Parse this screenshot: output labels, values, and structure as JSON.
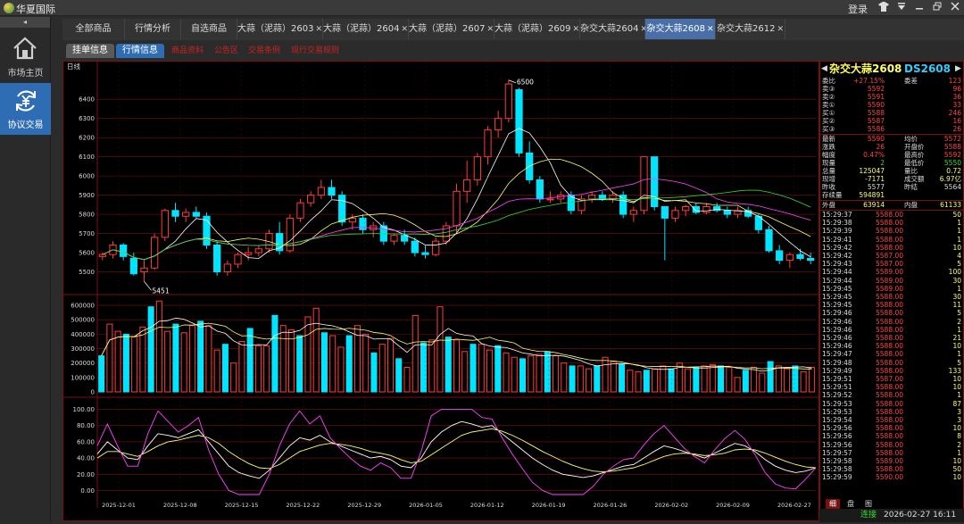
{
  "app": {
    "title": "华夏国际",
    "login": "登录"
  },
  "sidebar": {
    "collapse_icon": "◂",
    "items": [
      {
        "label": "市场主页",
        "icon": "home-icon",
        "active": false
      },
      {
        "label": "协议交易",
        "icon": "yuan-exchange-icon",
        "active": true
      }
    ]
  },
  "tabs": [
    {
      "label": "全部商品",
      "closable": false,
      "active": false
    },
    {
      "label": "行情分析",
      "closable": false,
      "active": false
    },
    {
      "label": "自选商品",
      "closable": false,
      "active": false
    },
    {
      "label": "大蒜（泥蒜）2603",
      "closable": true,
      "active": false
    },
    {
      "label": "大蒜（泥蒜）2604",
      "closable": true,
      "active": false
    },
    {
      "label": "大蒜（泥蒜）2607",
      "closable": true,
      "active": false
    },
    {
      "label": "大蒜（泥蒜）2609",
      "closable": true,
      "active": false
    },
    {
      "label": "杂交大蒜2604",
      "closable": true,
      "active": false
    },
    {
      "label": "杂交大蒜2608",
      "closable": true,
      "active": true
    },
    {
      "label": "杂交大蒜2612",
      "closable": true,
      "active": false
    }
  ],
  "subtabs": {
    "buttons": [
      "挂单信息",
      "行情信息"
    ],
    "links": [
      "商品资料",
      "公告区",
      "交易条例",
      "现行交易规则"
    ]
  },
  "chart": {
    "period_label": "日线",
    "price_high_label": "6500",
    "price_low_label": "5451",
    "colors": {
      "up": "#ff3b3b",
      "down": "#00e5ff",
      "ma1": "#ffffff",
      "ma2": "#ffff66",
      "ma3": "#ff44ff",
      "ma4": "#33dd33",
      "grid": "#7a1010"
    }
  },
  "chart_data": [
    {
      "type": "candlestick",
      "panel": "price",
      "ylim": [
        5400,
        6550
      ],
      "yticks": [
        5500,
        5600,
        5700,
        5800,
        5900,
        6000,
        6100,
        6200,
        6300,
        6400
      ],
      "x_tick_labels": [
        "2025-12-01",
        "2025-12-08",
        "2025-12-15",
        "2025-12-22",
        "2025-12-29",
        "2026-01-05",
        "2026-01-12",
        "2026-01-19",
        "2026-01-26",
        "2026-02-02",
        "2026-02-09",
        "2026-02-27"
      ],
      "candles": [
        [
          5580,
          5600,
          5560,
          5590
        ],
        [
          5590,
          5660,
          5570,
          5640
        ],
        [
          5640,
          5650,
          5560,
          5580
        ],
        [
          5570,
          5600,
          5480,
          5490
        ],
        [
          5500,
          5560,
          5450,
          5520
        ],
        [
          5520,
          5700,
          5510,
          5680
        ],
        [
          5680,
          5830,
          5660,
          5820
        ],
        [
          5820,
          5860,
          5760,
          5790
        ],
        [
          5790,
          5830,
          5760,
          5810
        ],
        [
          5810,
          5840,
          5780,
          5790
        ],
        [
          5790,
          5810,
          5620,
          5640
        ],
        [
          5640,
          5660,
          5480,
          5500
        ],
        [
          5500,
          5560,
          5480,
          5540
        ],
        [
          5540,
          5600,
          5520,
          5590
        ],
        [
          5590,
          5630,
          5560,
          5600
        ],
        [
          5600,
          5640,
          5580,
          5620
        ],
        [
          5620,
          5720,
          5600,
          5700
        ],
        [
          5700,
          5760,
          5590,
          5610
        ],
        [
          5610,
          5800,
          5600,
          5780
        ],
        [
          5780,
          5880,
          5760,
          5860
        ],
        [
          5860,
          5920,
          5840,
          5900
        ],
        [
          5900,
          5980,
          5880,
          5940
        ],
        [
          5940,
          5980,
          5880,
          5900
        ],
        [
          5900,
          5920,
          5740,
          5760
        ],
        [
          5760,
          5800,
          5720,
          5780
        ],
        [
          5780,
          5800,
          5700,
          5720
        ],
        [
          5720,
          5760,
          5680,
          5740
        ],
        [
          5740,
          5760,
          5640,
          5660
        ],
        [
          5660,
          5700,
          5640,
          5690
        ],
        [
          5690,
          5720,
          5640,
          5660
        ],
        [
          5660,
          5680,
          5580,
          5600
        ],
        [
          5600,
          5640,
          5570,
          5590
        ],
        [
          5590,
          5680,
          5580,
          5660
        ],
        [
          5660,
          5760,
          5640,
          5740
        ],
        [
          5740,
          5960,
          5700,
          5920
        ],
        [
          5920,
          6080,
          5860,
          5980
        ],
        [
          5980,
          6120,
          5950,
          6100
        ],
        [
          6100,
          6260,
          6060,
          6240
        ],
        [
          6240,
          6340,
          6200,
          6300
        ],
        [
          6300,
          6500,
          6280,
          6480
        ],
        [
          6450,
          6460,
          6100,
          6120
        ],
        [
          6120,
          6180,
          5960,
          5980
        ],
        [
          5980,
          6000,
          5860,
          5880
        ],
        [
          5880,
          5920,
          5860,
          5880
        ],
        [
          5880,
          5920,
          5860,
          5900
        ],
        [
          5900,
          5920,
          5800,
          5820
        ],
        [
          5820,
          5900,
          5800,
          5880
        ],
        [
          5880,
          5920,
          5860,
          5900
        ],
        [
          5900,
          5920,
          5870,
          5880
        ],
        [
          5880,
          5920,
          5860,
          5900
        ],
        [
          5900,
          5920,
          5780,
          5800
        ],
        [
          5800,
          5840,
          5760,
          5820
        ],
        [
          5820,
          6100,
          5800,
          6100
        ],
        [
          6100,
          6100,
          5820,
          5840
        ],
        [
          5840,
          5840,
          5560,
          5780
        ],
        [
          5780,
          5840,
          5760,
          5820
        ],
        [
          5820,
          5850,
          5790,
          5840
        ],
        [
          5840,
          5860,
          5800,
          5810
        ],
        [
          5810,
          5860,
          5800,
          5840
        ],
        [
          5840,
          5860,
          5810,
          5820
        ],
        [
          5820,
          5840,
          5780,
          5800
        ],
        [
          5800,
          5840,
          5780,
          5820
        ],
        [
          5820,
          5840,
          5780,
          5790
        ],
        [
          5790,
          5800,
          5700,
          5720
        ],
        [
          5720,
          5740,
          5600,
          5610
        ],
        [
          5610,
          5640,
          5540,
          5560
        ],
        [
          5560,
          5600,
          5520,
          5590
        ],
        [
          5590,
          5620,
          5560,
          5570
        ],
        [
          5570,
          5600,
          5540,
          5560
        ]
      ]
    },
    {
      "type": "bar",
      "panel": "volume",
      "ylim": [
        0,
        650000
      ],
      "yticks": [
        0,
        100000,
        200000,
        300000,
        400000,
        500000,
        600000
      ],
      "values": [
        250000,
        470000,
        420000,
        400000,
        380000,
        450000,
        590000,
        630000,
        420000,
        470000,
        410000,
        460000,
        490000,
        460000,
        290000,
        330000,
        200000,
        350000,
        440000,
        320000,
        320000,
        530000,
        460000,
        430000,
        390000,
        520000,
        580000,
        410000,
        390000,
        310000,
        390000,
        460000,
        400000,
        270000,
        330000,
        370000,
        230000,
        170000,
        530000,
        340000,
        360000,
        590000,
        380000,
        360000,
        280000,
        330000,
        330000,
        290000,
        320000,
        270000,
        240000,
        230000,
        250000,
        260000,
        280000,
        250000,
        200000,
        180000,
        180000,
        160000,
        180000,
        240000,
        210000,
        190000,
        150000,
        140000,
        150000,
        160000,
        180000,
        160000,
        200000,
        160000,
        170000,
        180000,
        190000,
        180000,
        170000,
        100000,
        150000,
        170000,
        130000,
        210000,
        180000,
        160000,
        180000,
        140000,
        170000
      ]
    },
    {
      "type": "line",
      "panel": "indicator",
      "ylim": [
        -5,
        105
      ],
      "yticks": [
        0,
        20,
        40,
        60,
        80,
        100
      ],
      "series": [
        {
          "name": "K",
          "values": [
            45,
            60,
            50,
            40,
            38,
            55,
            70,
            68,
            65,
            70,
            75,
            60,
            45,
            30,
            22,
            18,
            15,
            25,
            40,
            55,
            65,
            62,
            68,
            60,
            55,
            50,
            45,
            40,
            42,
            38,
            30,
            28,
            40,
            60,
            72,
            80,
            85,
            82,
            78,
            80,
            70,
            60,
            50,
            40,
            32,
            25,
            20,
            18,
            16,
            18,
            22,
            26,
            30,
            32,
            40,
            48,
            55,
            52,
            48,
            44,
            40,
            46,
            52,
            58,
            55,
            48,
            38,
            30,
            25,
            22,
            24,
            28
          ]
        },
        {
          "name": "D",
          "values": [
            40,
            48,
            48,
            45,
            42,
            48,
            55,
            60,
            62,
            65,
            68,
            65,
            58,
            48,
            40,
            33,
            28,
            27,
            32,
            40,
            48,
            52,
            56,
            58,
            57,
            55,
            52,
            48,
            46,
            43,
            38,
            34,
            36,
            44,
            52,
            60,
            68,
            72,
            74,
            76,
            73,
            68,
            62,
            55,
            48,
            42,
            36,
            31,
            27,
            24,
            23,
            24,
            26,
            28,
            32,
            37,
            42,
            45,
            46,
            45,
            43,
            44,
            46,
            50,
            51,
            50,
            46,
            41,
            36,
            32,
            29,
            28
          ]
        },
        {
          "name": "J",
          "values": [
            55,
            82,
            55,
            30,
            30,
            70,
            98,
            85,
            72,
            80,
            90,
            50,
            20,
            0,
            -5,
            -5,
            -5,
            20,
            55,
            82,
            98,
            82,
            92,
            65,
            52,
            40,
            30,
            25,
            34,
            28,
            15,
            15,
            48,
            92,
            100,
            100,
            100,
            100,
            90,
            88,
            65,
            45,
            27,
            10,
            0,
            -5,
            -5,
            -5,
            -5,
            5,
            20,
            30,
            38,
            40,
            56,
            70,
            80,
            66,
            52,
            42,
            34,
            50,
            64,
            74,
            63,
            44,
            22,
            8,
            3,
            2,
            14,
            28
          ]
        }
      ]
    }
  ],
  "quote": {
    "title_name": "杂交大蒜2608",
    "title_code": "DS2608",
    "rows_top": [
      {
        "l": "委比",
        "v": "+27.15%",
        "l2": "委差",
        "v2": "123",
        "vc": "#ff4444"
      },
      {
        "l": "卖③",
        "v": "5592",
        "l2": "",
        "v2": "96",
        "vc": "#ff4444"
      },
      {
        "l": "卖②",
        "v": "5591",
        "l2": "",
        "v2": "36",
        "vc": "#ff4444"
      },
      {
        "l": "卖①",
        "v": "5590",
        "l2": "",
        "v2": "33",
        "vc": "#ff4444"
      },
      {
        "l": "买①",
        "v": "5588",
        "l2": "",
        "v2": "246",
        "vc": "#ff4444"
      },
      {
        "l": "买②",
        "v": "5587",
        "l2": "",
        "v2": "16",
        "vc": "#ff4444"
      },
      {
        "l": "买③",
        "v": "5586",
        "l2": "",
        "v2": "26",
        "vc": "#ff4444"
      }
    ],
    "rows_mid": [
      {
        "l": "最新",
        "v": "5590",
        "l2": "均价",
        "v2": "5572",
        "vc": "#ff4444"
      },
      {
        "l": "涨跌",
        "v": "26",
        "l2": "开盘价",
        "v2": "5588",
        "vc": "#ff4444"
      },
      {
        "l": "幅度",
        "v": "0.47%",
        "l2": "最高价",
        "v2": "5592",
        "vc": "#ff4444"
      },
      {
        "l": "现量",
        "v": "2",
        "l2": "最低价",
        "v2": "5550",
        "vc": "#33dd33"
      },
      {
        "l": "总量",
        "v": "125047",
        "l2": "量比",
        "v2": "0.72",
        "vc": "#ffff66"
      },
      {
        "l": "现增",
        "v": "-7171",
        "l2": "成交额",
        "v2": "6.97亿",
        "vc": "#ffff66"
      },
      {
        "l": "昨收",
        "v": "5577",
        "l2": "昨结",
        "v2": "5564",
        "vc": "#dddddd"
      },
      {
        "l": "存续量",
        "v": "594891",
        "l2": "",
        "v2": "",
        "vc": "#ffff66"
      }
    ],
    "outer_inner": {
      "l": "外盘",
      "v": "63914",
      "l2": "内盘",
      "v2": "61133"
    },
    "ticks": [
      [
        "15:29:37",
        "5588.00",
        "50"
      ],
      [
        "15:29:38",
        "5588.00",
        "1"
      ],
      [
        "15:29:39",
        "5588.00",
        "1"
      ],
      [
        "15:29:41",
        "5588.00",
        "1"
      ],
      [
        "15:29:42",
        "5588.00",
        "10"
      ],
      [
        "15:29:42",
        "5587.00",
        "4"
      ],
      [
        "15:29:43",
        "5587.00",
        "5"
      ],
      [
        "15:29:44",
        "5589.00",
        "100"
      ],
      [
        "15:29:44",
        "5589.00",
        "30"
      ],
      [
        "15:29:45",
        "5589.00",
        "1"
      ],
      [
        "15:29:45",
        "5588.00",
        "30"
      ],
      [
        "15:29:45",
        "5588.00",
        "11"
      ],
      [
        "15:29:46",
        "5588.00",
        "5"
      ],
      [
        "15:29:46",
        "5588.00",
        "2"
      ],
      [
        "15:29:46",
        "5588.00",
        "1"
      ],
      [
        "15:29:46",
        "5588.00",
        "21"
      ],
      [
        "15:29:46",
        "5588.00",
        "10"
      ],
      [
        "15:29:47",
        "5588.00",
        "1"
      ],
      [
        "15:29:48",
        "5588.00",
        "5"
      ],
      [
        "15:29:49",
        "5588.00",
        "133"
      ],
      [
        "15:29:51",
        "5587.00",
        "10"
      ],
      [
        "15:29:51",
        "5588.00",
        "10"
      ],
      [
        "15:29:52",
        "5588.00",
        "1"
      ],
      [
        "15:29:53",
        "5588.00",
        "87"
      ],
      [
        "15:29:53",
        "5588.00",
        "3"
      ],
      [
        "15:29:54",
        "5588.00",
        "3"
      ],
      [
        "15:29:56",
        "5588.00",
        "10"
      ],
      [
        "15:29:56",
        "5588.00",
        "8"
      ],
      [
        "15:29:56",
        "5588.00",
        "2"
      ],
      [
        "15:29:57",
        "5588.00",
        "1"
      ],
      [
        "15:29:58",
        "5589.00",
        "10"
      ],
      [
        "15:29:58",
        "5588.00",
        "50"
      ],
      [
        "15:29:59",
        "5590.00",
        "10"
      ]
    ],
    "foot_tabs": [
      "细",
      "盘",
      "图"
    ],
    "status": {
      "conn": "连接",
      "datetime": "2026-02-27  16:11"
    }
  }
}
